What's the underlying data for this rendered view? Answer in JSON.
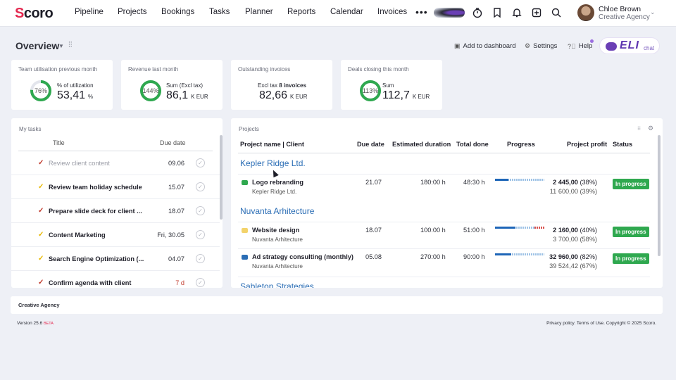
{
  "app": {
    "logo": "Scoro"
  },
  "nav": [
    "Pipeline",
    "Projects",
    "Bookings",
    "Tasks",
    "Planner",
    "Reports",
    "Calendar",
    "Invoices"
  ],
  "nav_more": "•••",
  "user": {
    "name": "Chloe Brown",
    "org": "Creative Agency"
  },
  "overview": {
    "title": "Overview",
    "add_to_dashboard": "Add to dashboard",
    "settings": "Settings",
    "help": "Help",
    "eli": "ELI",
    "eli_chat": "chat"
  },
  "kpis": [
    {
      "label": "Team utilisation previous month",
      "ring": "76%",
      "ring_value": 0.76,
      "sub": "% of utilization",
      "value": "53,41",
      "unit": "%"
    },
    {
      "label": "Revenue last month",
      "ring": "144%",
      "ring_value": 1.0,
      "sub": "Sum (Excl tax)",
      "value": "86,1",
      "unit": "K  EUR"
    },
    {
      "label": "Outstanding invoices",
      "sub_prefix": "Excl tax",
      "sub_bold": "8 invoices",
      "value": "82,66",
      "unit": "K  EUR"
    },
    {
      "label": "Deals closing this month",
      "ring": "113%",
      "ring_value": 1.0,
      "sub": "Sum",
      "value": "112,7",
      "unit": "K  EUR"
    }
  ],
  "tasks": {
    "title": "My tasks",
    "col_title": "Title",
    "col_due": "Due date",
    "rows": [
      {
        "title": "Review client content",
        "due": "09.06",
        "done": true,
        "check_color": "#c0392b",
        "due_red": false
      },
      {
        "title": "Review team holiday schedule",
        "due": "15.07",
        "done": false,
        "check_color": "#e8b800",
        "due_red": false
      },
      {
        "title": "Prepare slide deck for client ...",
        "due": "18.07",
        "done": false,
        "check_color": "#c0392b",
        "due_red": false
      },
      {
        "title": "Content Marketing",
        "due": "Fri, 30.05",
        "done": false,
        "check_color": "#e8b800",
        "due_red": false
      },
      {
        "title": "Search Engine Optimization (...",
        "due": "04.07",
        "done": false,
        "check_color": "#e8b800",
        "due_red": false
      },
      {
        "title": "Confirm agenda with client",
        "due": "7 d",
        "done": false,
        "check_color": "#c0392b",
        "due_red": true
      }
    ]
  },
  "projects": {
    "title": "Projects",
    "columns": [
      "Project name | Client",
      "Due date",
      "Estimated duration",
      "Total done",
      "Progress",
      "Project profit",
      "Status"
    ],
    "groups": [
      {
        "client": "Kepler Ridge Ltd.",
        "rows": [
          {
            "name": "Logo rebranding",
            "client": "Kepler Ridge Ltd.",
            "icon_color": "#2fa84f",
            "due": "21.07",
            "est": "180:00 h",
            "done": "48:30 h",
            "progress": 0.27,
            "overrun": 0,
            "profit": "2 445,00",
            "profit_pct": "(38%)",
            "profit2": "11 600,00 (39%)",
            "status": "In progress"
          }
        ]
      },
      {
        "client": "Nuvanta Arhitecture",
        "rows": [
          {
            "name": "Website design",
            "client": "Nuvanta Arhitecture",
            "icon_color": "#f3d36b",
            "due": "18.07",
            "est": "100:00 h",
            "done": "51:00 h",
            "progress": 0.42,
            "overrun": 0.2,
            "profit": "2 160,00",
            "profit_pct": "(40%)",
            "profit2": "3 700,00 (58%)",
            "status": "In progress"
          },
          {
            "name": "Ad strategy consulting (monthly)",
            "client": "Nuvanta Arhitecture",
            "icon_color": "#2a6db5",
            "due": "05.08",
            "est": "270:00 h",
            "done": "90:00 h",
            "progress": 0.33,
            "overrun": 0,
            "profit": "32 960,00",
            "profit_pct": "(82%)",
            "profit2": "39 524,42 (67%)",
            "status": "In progress"
          }
        ]
      },
      {
        "client": "Sableton Strategies",
        "rows": []
      }
    ]
  },
  "footer": {
    "band": "Creative Agency",
    "version": "Version 25.6",
    "beta": "BETA",
    "copyright": "Privacy policy. Terms of Use. Copyright © 2025 Scoro."
  }
}
